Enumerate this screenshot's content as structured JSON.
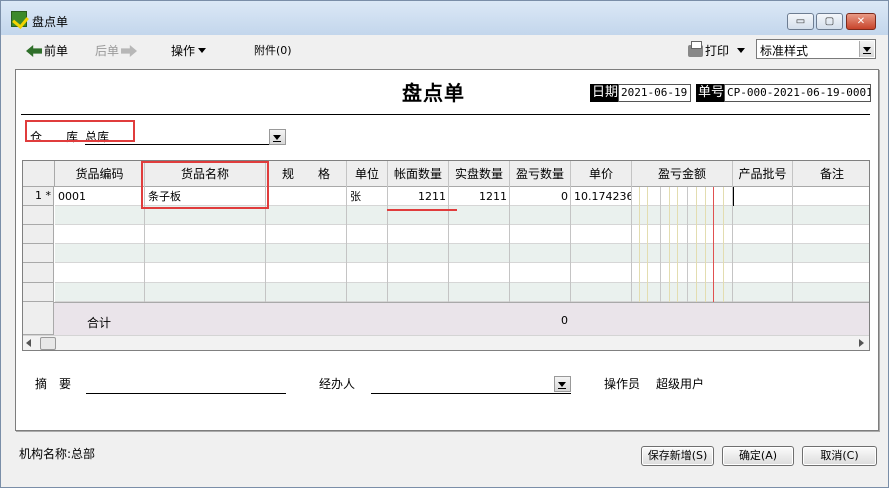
{
  "window": {
    "title": "盘点单",
    "controls": {
      "minimize": "▭",
      "maximize": "▢",
      "close": "✕"
    }
  },
  "toolbar": {
    "prev": "前单",
    "next": "后单",
    "operations": "操作",
    "attachments": "附件(0)",
    "print": "打印",
    "print_style": "标准样式"
  },
  "document": {
    "title": "盘点单",
    "date_label": "日期",
    "date_value": "2021-06-19",
    "number_label": "单号",
    "number_value": "CP-000-2021-06-19-0001",
    "warehouse_label": "仓　　库",
    "warehouse_value": "总库"
  },
  "grid": {
    "headers": [
      "货品编码",
      "货品名称",
      "规　　格",
      "单位",
      "帐面数量",
      "实盘数量",
      "盈亏数量",
      "单价",
      "盈亏金额",
      "产品批号",
      "备注"
    ],
    "rows": [
      {
        "row_header": "1 *",
        "code": "0001",
        "name": "条子板",
        "spec": "",
        "unit": "张",
        "book_qty": "1211",
        "actual_qty": "1211",
        "diff_qty": "0",
        "unit_price": "10.174236",
        "diff_amount": "",
        "batch": "",
        "note": ""
      }
    ],
    "total_label": "合计",
    "total_diff_qty": "0"
  },
  "footer": {
    "summary_label": "摘　要",
    "summary_value": "",
    "handler_label": "经办人",
    "handler_value": "",
    "operator_label": "操作员",
    "operator_value": "超级用户"
  },
  "status": {
    "org_label": "机构名称:",
    "org_value": "总部"
  },
  "buttons": {
    "save_new": "保存新增(S)",
    "confirm": "确定(A)",
    "cancel": "取消(C)"
  },
  "colors": {
    "highlight": "#e03c3c",
    "grid_alt_row": "#eaf1ee",
    "total_row": "#eae4ea"
  }
}
